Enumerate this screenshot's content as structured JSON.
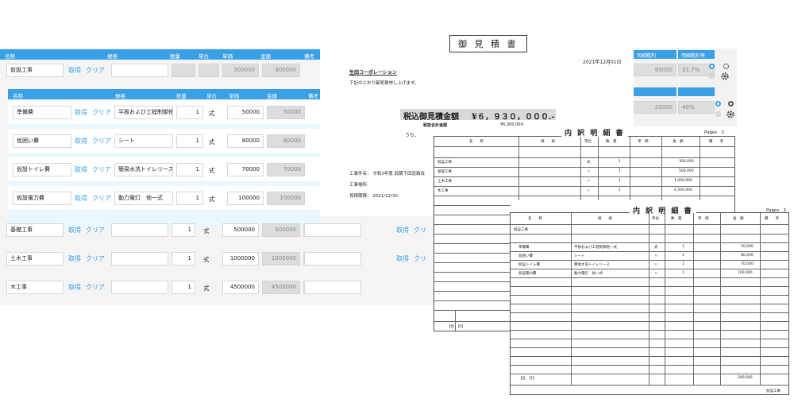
{
  "doc": {
    "title": "御 見 積 書",
    "date": "2021年12月01日",
    "customer": "生田コーポレーション",
    "intro": "下記のとおり御見積申し上げます。",
    "total_label": "税込御見積金額",
    "total_value": "¥６，９３０，０００.-",
    "sub_amount_label": "税抜合計金額",
    "sub_amount_value": "¥6,300,000-",
    "sub_tax": "うち、",
    "work_name": "工事件名： 令和3年度 武蔵下田道路改",
    "work_place": "工事場所:",
    "valid_until": "見積期限： 2021/12/30"
  },
  "form": {
    "headers": [
      "名称",
      "規格",
      "数量",
      "単位",
      "単価",
      "金額",
      "備考"
    ],
    "sub_headers": [
      "名称",
      "規格",
      "数量",
      "単位",
      "単価",
      "金額",
      "備考"
    ],
    "link_get": "取得",
    "link_clear": "クリア",
    "link_clear_cut": "クリ",
    "parent_top": {
      "name": "仮設工事",
      "qty": "1",
      "unit": "式",
      "price": "300000",
      "amount": "300000"
    },
    "children": [
      {
        "name": "準備費",
        "spec": "平板および工程制御他一",
        "qty": "1",
        "unit": "式",
        "price": "50000",
        "amount": "50000"
      },
      {
        "name": "仮囲い費",
        "spec": "シート",
        "qty": "1",
        "unit": "式",
        "price": "80000",
        "amount": "80000"
      },
      {
        "name": "仮設トイレ費",
        "spec": "簡易水洗トイレリース",
        "qty": "1",
        "unit": "式",
        "price": "70000",
        "amount": "70000"
      },
      {
        "name": "仮設電力費",
        "spec": "動力電灯　他一式",
        "qty": "1",
        "unit": "式",
        "price": "100000",
        "amount": "100000"
      }
    ],
    "parents": [
      {
        "name": "基礎工事",
        "qty": "1",
        "unit": "式",
        "price": "500000",
        "amount": "500000"
      },
      {
        "name": "土木工事",
        "qty": "1",
        "unit": "式",
        "price": "1000000",
        "amount": "1000000"
      },
      {
        "name": "木工事",
        "qty": "1",
        "unit": "式",
        "price": "4500000",
        "amount": "4500000"
      }
    ]
  },
  "rpanel": {
    "col1": "明細粗利",
    "col2": "明細粗利率",
    "row1_profit": "95000",
    "row1_rate": "31.7%",
    "row2_profit": "20000",
    "row2_rate": "40%"
  },
  "sheet1": {
    "title": "内 訳 明 細 書",
    "pages_label": "Pages",
    "pages_value": "2",
    "headers": [
      "名　　称",
      "規　　格",
      "単位",
      "数　量",
      "単　価",
      "金　額",
      "備　　考"
    ],
    "rows": [
      {
        "name": "仮設工事",
        "unit": "式",
        "qty": "1",
        "amount": "300,000"
      },
      {
        "name": "基礎工事",
        "unit": "〃",
        "qty": "1",
        "amount": "500,000"
      },
      {
        "name": "土木工事",
        "unit": "〃",
        "qty": "1",
        "amount": "1,000,000"
      },
      {
        "name": "木工事",
        "unit": "〃",
        "qty": "1",
        "amount": "4,500,000"
      }
    ],
    "total_label": "【合　計】"
  },
  "sheet2": {
    "title": "内 訳 明 細 書",
    "pages_label": "Pages",
    "pages_value": "3",
    "headers": [
      "名　　称",
      "規　　格",
      "単位",
      "数　量",
      "単　価",
      "金　額",
      "備　　考"
    ],
    "group": "仮設工事",
    "rows": [
      {
        "name": "準備費",
        "spec": "平板および工程制御他一式",
        "unit": "式",
        "qty": "1",
        "amount": "50,000"
      },
      {
        "name": "仮囲い費",
        "spec": "シート",
        "unit": "〃",
        "qty": "1",
        "amount": "80,000"
      },
      {
        "name": "仮設トイレ費",
        "spec": "簡易水洗トイレリース",
        "unit": "〃",
        "qty": "1",
        "amount": "70,000"
      },
      {
        "name": "仮設電力費",
        "spec": "動力電灯　他一式",
        "unit": "〃",
        "qty": "1",
        "amount": "100,000"
      }
    ],
    "total_label": "【合　計】",
    "total_value": "300,000",
    "footer": "仮設工事"
  },
  "colors": {
    "accent": "#3aa0e6",
    "link": "#3aa0e6",
    "readonly": "#dddddd"
  }
}
